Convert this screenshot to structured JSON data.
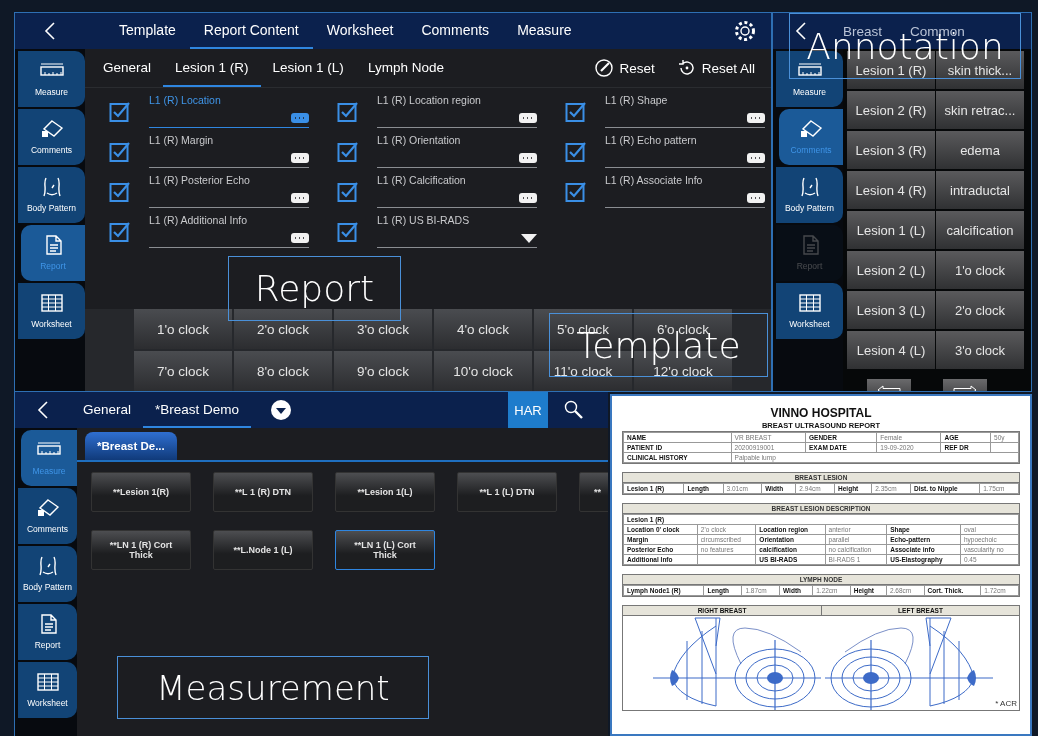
{
  "report_content_panel": {
    "tabs": [
      {
        "label": "Template",
        "selected": false
      },
      {
        "label": "Report Content",
        "selected": true
      },
      {
        "label": "Worksheet",
        "selected": false
      },
      {
        "label": "Comments",
        "selected": false
      },
      {
        "label": "Measure",
        "selected": false
      }
    ],
    "sidebar": [
      {
        "label": "Measure",
        "selected": false,
        "disabled": false
      },
      {
        "label": "Comments",
        "selected": false,
        "disabled": false
      },
      {
        "label": "Body Pattern",
        "selected": false,
        "disabled": false
      },
      {
        "label": "Report",
        "selected": true,
        "disabled": false
      },
      {
        "label": "Worksheet",
        "selected": false,
        "disabled": false
      }
    ],
    "subtabs": [
      {
        "label": "General",
        "selected": false
      },
      {
        "label": "Lesion 1 (R)",
        "selected": true
      },
      {
        "label": "Lesion 1 (L)",
        "selected": false
      },
      {
        "label": "Lymph Node",
        "selected": false
      }
    ],
    "actions": [
      "Reset",
      "Reset All"
    ],
    "fields": [
      {
        "label": "L1 (R) Location",
        "checked": true,
        "focused": true,
        "kind": "text"
      },
      {
        "label": "L1 (R) Location region",
        "checked": true,
        "focused": false,
        "kind": "text"
      },
      {
        "label": "L1 (R) Shape",
        "checked": true,
        "focused": false,
        "kind": "text"
      },
      {
        "label": "L1 (R) Margin",
        "checked": true,
        "focused": false,
        "kind": "text"
      },
      {
        "label": "L1 (R) Orientation",
        "checked": true,
        "focused": false,
        "kind": "text"
      },
      {
        "label": "L1 (R) Echo pattern",
        "checked": true,
        "focused": false,
        "kind": "text"
      },
      {
        "label": "L1 (R) Posterior Echo",
        "checked": true,
        "focused": false,
        "kind": "text"
      },
      {
        "label": "L1 (R) Calcification",
        "checked": true,
        "focused": false,
        "kind": "text"
      },
      {
        "label": "L1 (R) Associate Info",
        "checked": true,
        "focused": false,
        "kind": "text"
      },
      {
        "label": "L1 (R) Additional Info",
        "checked": true,
        "focused": false,
        "kind": "text"
      },
      {
        "label": "L1 (R) US BI-RADS",
        "checked": true,
        "focused": false,
        "kind": "dropdown"
      }
    ],
    "template_buttons": [
      "1'o clock",
      "2'o clock",
      "3'o clock",
      "4'o clock",
      "5'o clock",
      "6'o clock",
      "7'o clock",
      "8'o clock",
      "9'o clock",
      "10'o clock",
      "11'o clock",
      "12'o clock"
    ],
    "callouts": [
      "Report",
      "Template"
    ]
  },
  "annotation_panel": {
    "tabs": [
      "Breast",
      "Common"
    ],
    "sidebar": [
      {
        "label": "Measure",
        "selected": false,
        "disabled": false
      },
      {
        "label": "Comments",
        "selected": true,
        "disabled": false
      },
      {
        "label": "Body Pattern",
        "selected": false,
        "disabled": false
      },
      {
        "label": "Report",
        "selected": false,
        "disabled": true
      },
      {
        "label": "Worksheet",
        "selected": false,
        "disabled": false
      }
    ],
    "lesions": [
      "Lesion 1 (R)",
      "Lesion 2 (R)",
      "Lesion 3 (R)",
      "Lesion 4 (R)",
      "Lesion 1 (L)",
      "Lesion 2 (L)",
      "Lesion 3 (L)",
      "Lesion 4 (L)"
    ],
    "terms": [
      "skin thick...",
      "skin retrac...",
      "edema",
      "intraductal",
      "calcification",
      "1'o clock",
      "2'o clock",
      "3'o clock"
    ],
    "callouts": [
      "Annotation"
    ]
  },
  "measurement_panel": {
    "tabs": [
      {
        "label": "General",
        "selected": false
      },
      {
        "label": "*Breast Demo",
        "selected": true
      }
    ],
    "har_button": {
      "label": "HAR",
      "on": true
    },
    "sidebar": [
      {
        "label": "Measure",
        "selected": true,
        "disabled": false
      },
      {
        "label": "Comments",
        "selected": false,
        "disabled": false
      },
      {
        "label": "Body Pattern",
        "selected": false,
        "disabled": false
      },
      {
        "label": "Report",
        "selected": false,
        "disabled": false
      },
      {
        "label": "Worksheet",
        "selected": false,
        "disabled": false
      }
    ],
    "group_tab": "*Breast De...",
    "buttons": [
      {
        "label": "**Lesion 1(R)",
        "selected": false
      },
      {
        "label": "**L 1 (R) DTN",
        "selected": false
      },
      {
        "label": "**Lesion 1(L)",
        "selected": false
      },
      {
        "label": "**L 1 (L) DTN",
        "selected": false
      },
      {
        "label": "**",
        "selected": false
      },
      {
        "label": "**LN 1 (R) Cort Thick",
        "selected": false
      },
      {
        "label": "**L.Node 1 (L)",
        "selected": false
      },
      {
        "label": "**LN 1 (L) Cort Thick",
        "selected": true
      }
    ],
    "callouts": [
      "Measurement"
    ]
  },
  "report_document": {
    "title": "VINNO HOSPITAL",
    "subtitle": "BREAST ULTRASOUND REPORT",
    "sections": [
      {
        "rows": [
          [
            {
              "kind": "label",
              "text": "NAME"
            },
            {
              "kind": "value",
              "text": "VR BREAST"
            },
            {
              "kind": "label",
              "text": "GENDER"
            },
            {
              "kind": "value",
              "text": "Female"
            },
            {
              "kind": "label",
              "text": "AGE"
            },
            {
              "kind": "value",
              "text": "50y"
            }
          ],
          [
            {
              "kind": "label",
              "text": "PATIENT ID"
            },
            {
              "kind": "value",
              "text": "20200919001"
            },
            {
              "kind": "label",
              "text": "EXAM DATE"
            },
            {
              "kind": "value",
              "text": "19-09-2020"
            },
            {
              "kind": "label",
              "text": "REF DR"
            },
            {
              "kind": "blank"
            }
          ],
          [
            {
              "kind": "label",
              "text": "CLINICAL HISTORY"
            },
            {
              "kind": "value",
              "text": "Palpable lump",
              "colspan": 5
            }
          ]
        ]
      },
      {
        "title": "BREAST LESION",
        "rows": [
          [
            {
              "kind": "label",
              "text": "Lesion 1 (R)"
            },
            {
              "kind": "label",
              "text": "Length"
            },
            {
              "kind": "value",
              "text": "3.01cm"
            },
            {
              "kind": "label",
              "text": "Width"
            },
            {
              "kind": "value",
              "text": "2.94cm"
            },
            {
              "kind": "label",
              "text": "Height"
            },
            {
              "kind": "value",
              "text": "2.35cm"
            },
            {
              "kind": "label",
              "text": "Dist. to Nipple"
            },
            {
              "kind": "value",
              "text": "1.75cm"
            }
          ]
        ]
      },
      {
        "title": "BREAST LESION DESCRIPTION",
        "rows": [
          [
            {
              "kind": "label",
              "text": "Lesion 1 (R)",
              "colspan": 6
            }
          ],
          [
            {
              "kind": "label",
              "text": "Location 0' clock"
            },
            {
              "kind": "value",
              "text": "2'o clock"
            },
            {
              "kind": "label",
              "text": "Location region"
            },
            {
              "kind": "value",
              "text": "anterior"
            },
            {
              "kind": "label",
              "text": "Shape"
            },
            {
              "kind": "value",
              "text": "oval"
            }
          ],
          [
            {
              "kind": "label",
              "text": "Margin"
            },
            {
              "kind": "value",
              "text": "circumscribed"
            },
            {
              "kind": "label",
              "text": "Orientation"
            },
            {
              "kind": "value",
              "text": "parallel"
            },
            {
              "kind": "label",
              "text": "Echo-pattern"
            },
            {
              "kind": "value",
              "text": "hypoechoic"
            }
          ],
          [
            {
              "kind": "label",
              "text": "Posterior Echo"
            },
            {
              "kind": "value",
              "text": "no features"
            },
            {
              "kind": "label",
              "text": "calcification"
            },
            {
              "kind": "value",
              "text": "no calcification"
            },
            {
              "kind": "label",
              "text": "Associate info"
            },
            {
              "kind": "value",
              "text": "vascularity no"
            }
          ],
          [
            {
              "kind": "label",
              "text": "Additional Info"
            },
            {
              "kind": "blank"
            },
            {
              "kind": "label",
              "text": "US BI-RADS"
            },
            {
              "kind": "value",
              "text": "BI-RADS 1"
            },
            {
              "kind": "label",
              "text": "US-Elastography"
            },
            {
              "kind": "value",
              "text": "0.45"
            }
          ]
        ]
      },
      {
        "title": "LYMPH NODE",
        "rows": [
          [
            {
              "kind": "label",
              "text": "Lymph Node1 (R)"
            },
            {
              "kind": "label",
              "text": "Length"
            },
            {
              "kind": "value",
              "text": "1.87cm"
            },
            {
              "kind": "label",
              "text": "Width"
            },
            {
              "kind": "value",
              "text": "1.22cm"
            },
            {
              "kind": "label",
              "text": "Height"
            },
            {
              "kind": "value",
              "text": "2.68cm"
            },
            {
              "kind": "label",
              "text": "Cort. Thick."
            },
            {
              "kind": "value",
              "text": "1.72cm"
            }
          ]
        ]
      }
    ],
    "diagram_headers": [
      "RIGHT BREAST",
      "LEFT BREAST"
    ],
    "footnote": "* ACR"
  }
}
